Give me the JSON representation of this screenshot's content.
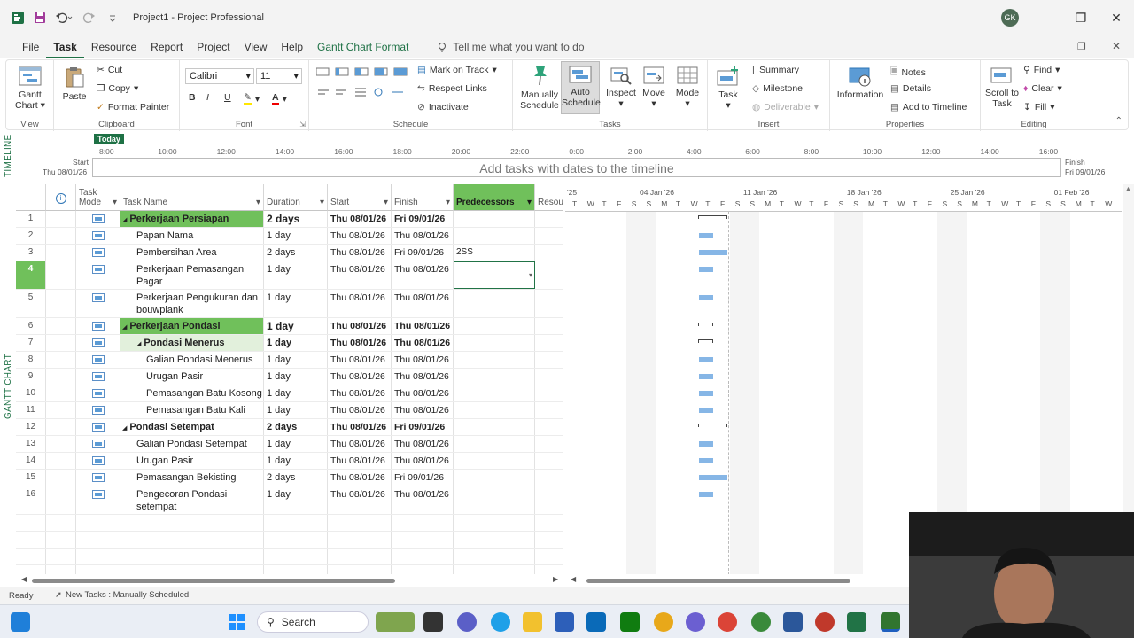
{
  "window": {
    "title": "Project1 - Project Professional",
    "avatar_initials": "GK"
  },
  "menu": {
    "items": [
      "File",
      "Task",
      "Resource",
      "Report",
      "Project",
      "View",
      "Help"
    ],
    "context_tab": "Gantt Chart Format",
    "tell_me": "Tell me what you want to do"
  },
  "ribbon": {
    "view": {
      "gantt_chart": "Gantt Chart",
      "group": "View"
    },
    "clipboard": {
      "paste": "Paste",
      "cut": "Cut",
      "copy": "Copy",
      "format_painter": "Format Painter",
      "group": "Clipboard"
    },
    "font": {
      "family": "Calibri",
      "size": "11",
      "group": "Font"
    },
    "schedule": {
      "mark_on_track": "Mark on Track",
      "respect_links": "Respect Links",
      "inactivate": "Inactivate",
      "group": "Schedule"
    },
    "tasks": {
      "manually_schedule": "Manually Schedule",
      "auto_schedule": "Auto Schedule",
      "inspect": "Inspect",
      "move": "Move",
      "mode": "Mode",
      "group": "Tasks"
    },
    "insert": {
      "task": "Task",
      "summary": "Summary",
      "milestone": "Milestone",
      "deliverable": "Deliverable",
      "group": "Insert"
    },
    "properties": {
      "information": "Information",
      "notes": "Notes",
      "details": "Details",
      "add_to_timeline": "Add to Timeline",
      "group": "Properties"
    },
    "editing": {
      "scroll_to_task": "Scroll to Task",
      "find": "Find",
      "clear": "Clear",
      "fill": "Fill",
      "group": "Editing"
    }
  },
  "timeline": {
    "side_label": "TIMELINE",
    "today": "Today",
    "start_label": "Start",
    "start_date": "Thu 08/01/26",
    "finish_label": "Finish",
    "finish_date": "Fri 09/01/26",
    "placeholder": "Add tasks with dates to the timeline",
    "ticks": [
      "8:00",
      "10:00",
      "12:00",
      "14:00",
      "16:00",
      "18:00",
      "20:00",
      "22:00",
      "0:00",
      "2:00",
      "4:00",
      "6:00",
      "8:00",
      "10:00",
      "12:00",
      "14:00",
      "16:00"
    ]
  },
  "grid": {
    "side_label": "GANTT CHART",
    "headers": {
      "info": "i",
      "mode": "Task Mode",
      "name": "Task Name",
      "duration": "Duration",
      "start": "Start",
      "finish": "Finish",
      "predecessors": "Predecessors",
      "resource": "Resou"
    },
    "rows": [
      {
        "id": "1",
        "name": "Perkerjaan Persiapan",
        "duration": "2 days",
        "start": "Thu 08/01/26",
        "finish": "Fri 09/01/26",
        "pred": "",
        "level": 0,
        "summary": true,
        "hl": true
      },
      {
        "id": "2",
        "name": "Papan Nama",
        "duration": "1 day",
        "start": "Thu 08/01/26",
        "finish": "Thu 08/01/26",
        "pred": "",
        "level": 1
      },
      {
        "id": "3",
        "name": "Pembersihan Area",
        "duration": "2 days",
        "start": "Thu 08/01/26",
        "finish": "Fri 09/01/26",
        "pred": "2SS",
        "level": 1
      },
      {
        "id": "4",
        "name": "Perkerjaan Pemasangan Pagar",
        "duration": "1 day",
        "start": "Thu 08/01/26",
        "finish": "Thu 08/01/26",
        "pred": "",
        "level": 1,
        "tall": true,
        "selected": true
      },
      {
        "id": "5",
        "name": "Perkerjaan Pengukuran dan bouwplank",
        "duration": "1 day",
        "start": "Thu 08/01/26",
        "finish": "Thu 08/01/26",
        "pred": "",
        "level": 1,
        "tall": true
      },
      {
        "id": "6",
        "name": "Perkerjaan Pondasi",
        "duration": "1 day",
        "start": "Thu 08/01/26",
        "finish": "Thu 08/01/26",
        "pred": "",
        "level": 0,
        "summary": true,
        "hl": true
      },
      {
        "id": "7",
        "name": "Pondasi Menerus",
        "duration": "1 day",
        "start": "Thu 08/01/26",
        "finish": "Thu 08/01/26",
        "pred": "",
        "level": 1,
        "summary": true,
        "lhl": true
      },
      {
        "id": "8",
        "name": "Galian Pondasi Menerus",
        "duration": "1 day",
        "start": "Thu 08/01/26",
        "finish": "Thu 08/01/26",
        "pred": "",
        "level": 2
      },
      {
        "id": "9",
        "name": "Urugan Pasir",
        "duration": "1 day",
        "start": "Thu 08/01/26",
        "finish": "Thu 08/01/26",
        "pred": "",
        "level": 2
      },
      {
        "id": "10",
        "name": "Pemasangan Batu Kosong",
        "duration": "1 day",
        "start": "Thu 08/01/26",
        "finish": "Thu 08/01/26",
        "pred": "",
        "level": 2
      },
      {
        "id": "11",
        "name": "Pemasangan Batu Kali",
        "duration": "1 day",
        "start": "Thu 08/01/26",
        "finish": "Thu 08/01/26",
        "pred": "",
        "level": 2
      },
      {
        "id": "12",
        "name": "Pondasi Setempat",
        "duration": "2 days",
        "start": "Thu 08/01/26",
        "finish": "Fri 09/01/26",
        "pred": "",
        "level": 0,
        "summary": true
      },
      {
        "id": "13",
        "name": "Galian Pondasi Setempat",
        "duration": "1 day",
        "start": "Thu 08/01/26",
        "finish": "Thu 08/01/26",
        "pred": "",
        "level": 1
      },
      {
        "id": "14",
        "name": "Urugan Pasir",
        "duration": "1 day",
        "start": "Thu 08/01/26",
        "finish": "Thu 08/01/26",
        "pred": "",
        "level": 1
      },
      {
        "id": "15",
        "name": "Pemasangan Bekisting",
        "duration": "2 days",
        "start": "Thu 08/01/26",
        "finish": "Fri 09/01/26",
        "pred": "",
        "level": 1
      },
      {
        "id": "16",
        "name": "Pengecoran Pondasi setempat",
        "duration": "1 day",
        "start": "Thu 08/01/26",
        "finish": "Thu 08/01/26",
        "pred": "",
        "level": 1,
        "tall": true
      }
    ]
  },
  "gantt": {
    "weeks": [
      "'25",
      "04 Jan '26",
      "11 Jan '26",
      "18 Jan '26",
      "25 Jan '26",
      "01 Feb '26"
    ],
    "day_letters": [
      "T",
      "W",
      "T",
      "F",
      "S",
      "S",
      "M",
      "T",
      "W",
      "T",
      "F",
      "S",
      "S",
      "M",
      "T",
      "W",
      "T",
      "F",
      "S",
      "S",
      "M",
      "T",
      "W",
      "T",
      "F",
      "S",
      "S",
      "M",
      "T",
      "W",
      "T",
      "F",
      "S",
      "S",
      "M",
      "T",
      "W"
    ]
  },
  "status": {
    "ready": "Ready",
    "new_tasks": "New Tasks : Manually Scheduled"
  },
  "taskbar": {
    "search": "Search"
  }
}
